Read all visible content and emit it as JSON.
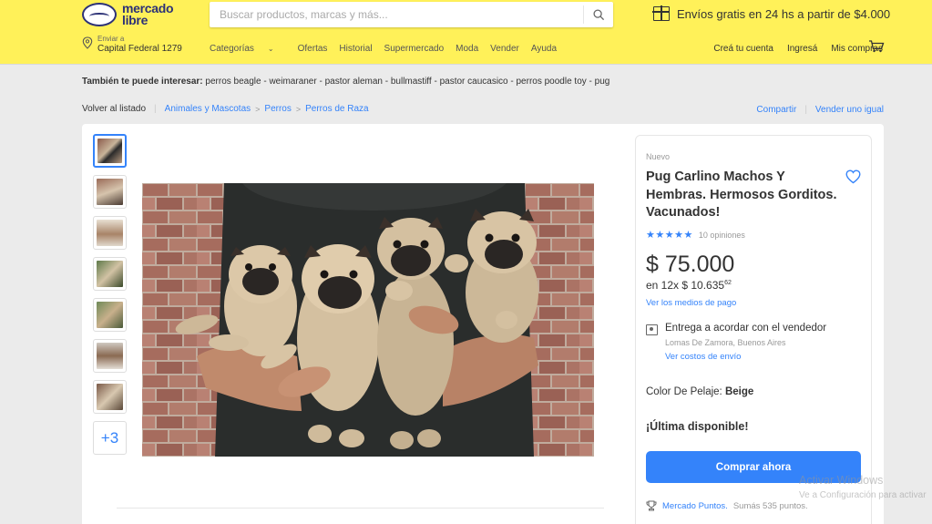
{
  "header": {
    "logo_line1": "mercado",
    "logo_line2": "libre",
    "search_placeholder": "Buscar productos, marcas y más...",
    "promo": "Envíos gratis en 24 hs a partir de $4.000",
    "location_label": "Enviar a",
    "location": "Capital Federal 1279",
    "nav": [
      "Categorías",
      "Ofertas",
      "Historial",
      "Supermercado",
      "Moda",
      "Vender",
      "Ayuda"
    ],
    "user_nav": [
      "Creá tu cuenta",
      "Ingresá",
      "Mis compras"
    ]
  },
  "suggestions": {
    "label": "También te puede interesar:",
    "items": "perros beagle - weimaraner - pastor aleman - bullmastiff - pastor caucasico - perros poodle toy - pug"
  },
  "breadcrumb": {
    "back": "Volver al listado",
    "items": [
      "Animales y Mascotas",
      "Perros",
      "Perros de Raza"
    ],
    "share": "Compartir",
    "sell": "Vender uno igual"
  },
  "gallery": {
    "more_label": "+3"
  },
  "product": {
    "condition": "Nuevo",
    "title": "Pug Carlino Machos Y Hembras. Hermosos Gorditos. Vacunados!",
    "rating": 5,
    "reviews": "10 opiniones",
    "price": "$ 75.000",
    "installments_prefix": "en 12x $ 10.635",
    "installments_cents": "62",
    "payment_link": "Ver los medios de pago",
    "shipping_title": "Entrega a acordar con el vendedor",
    "shipping_location": "Lomas De Zamora, Buenos Aires",
    "shipping_link": "Ver costos de envío",
    "color_label": "Color De Pelaje:",
    "color_value": "Beige",
    "stock": "¡Última disponible!",
    "buy_button": "Comprar ahora",
    "points_link": "Mercado Puntos.",
    "points_text": "Sumás 535 puntos."
  },
  "watermark": {
    "line1": "Activar Windows",
    "line2": "Ve a Configuración para activar"
  },
  "colors": {
    "header_bg": "#fff159",
    "accent": "#3483fa",
    "brand_navy": "#2d3277"
  }
}
